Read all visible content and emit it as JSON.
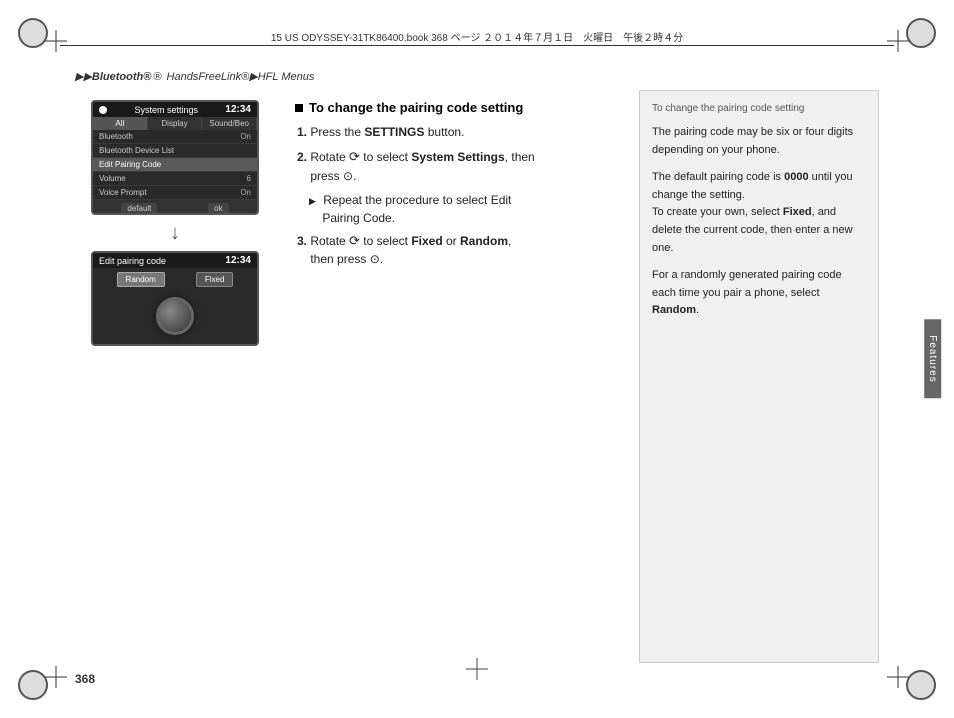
{
  "page": {
    "number": "368",
    "top_text": "15 US ODYSSEY-31TK86400.book   368 ページ   ２０１４年７月１日　火曜日　午後２時４分"
  },
  "breadcrumb": {
    "prefix": "▶▶",
    "part1": "Bluetooth®",
    "part2": "HandsFreeLink®",
    "part3": "HFL Menus"
  },
  "top_screen": {
    "title": "System settings",
    "time": "12:34",
    "tabs": [
      "All",
      "Display",
      "Sound/Beo"
    ],
    "menu_items": [
      {
        "label": "Bluetooth",
        "value": "On"
      },
      {
        "label": "Bluetooth Device List",
        "value": ""
      },
      {
        "label": "Edit Pairing Code",
        "value": "",
        "highlighted": true
      },
      {
        "label": "Volume",
        "value": "6"
      },
      {
        "label": "Voice Prompt",
        "value": "On"
      }
    ],
    "footer_buttons": [
      "default",
      "ok"
    ]
  },
  "bottom_screen": {
    "title": "Edit pairing code",
    "time": "12:34",
    "buttons": [
      "Random",
      "Fixed"
    ]
  },
  "instructions": {
    "title": "To change the pairing code setting",
    "steps": [
      {
        "num": "1.",
        "text": "Press the ",
        "bold": "SETTINGS",
        "text2": " button."
      },
      {
        "num": "2.",
        "text": "Rotate ",
        "dial": "⟳",
        "text2": " to select ",
        "bold": "System Settings",
        "text3": ", then press ",
        "press": "⊙",
        "text4": "."
      },
      {
        "sub": "Repeat the procedure to select ",
        "bold": "Edit Pairing Code",
        "text": "."
      },
      {
        "num": "3.",
        "text": "Rotate ",
        "dial": "⟳",
        "text2": " to select ",
        "bold1": "Fixed",
        "text3": " or ",
        "bold2": "Random",
        "text4": ", then press ",
        "press": "⊙",
        "text5": "."
      }
    ]
  },
  "note_box": {
    "title": "To change the pairing code setting",
    "paragraphs": [
      "The pairing code may be six or four digits depending on your phone.",
      "The default pairing code is 0000 until you change the setting.\nTo create your own, select Fixed, and delete the current code, then enter a new one.",
      "For a randomly generated pairing code each time you pair a phone, select Random."
    ],
    "bold_words": [
      "0000",
      "Fixed",
      "Random"
    ]
  },
  "features_tab": {
    "label": "Features"
  }
}
